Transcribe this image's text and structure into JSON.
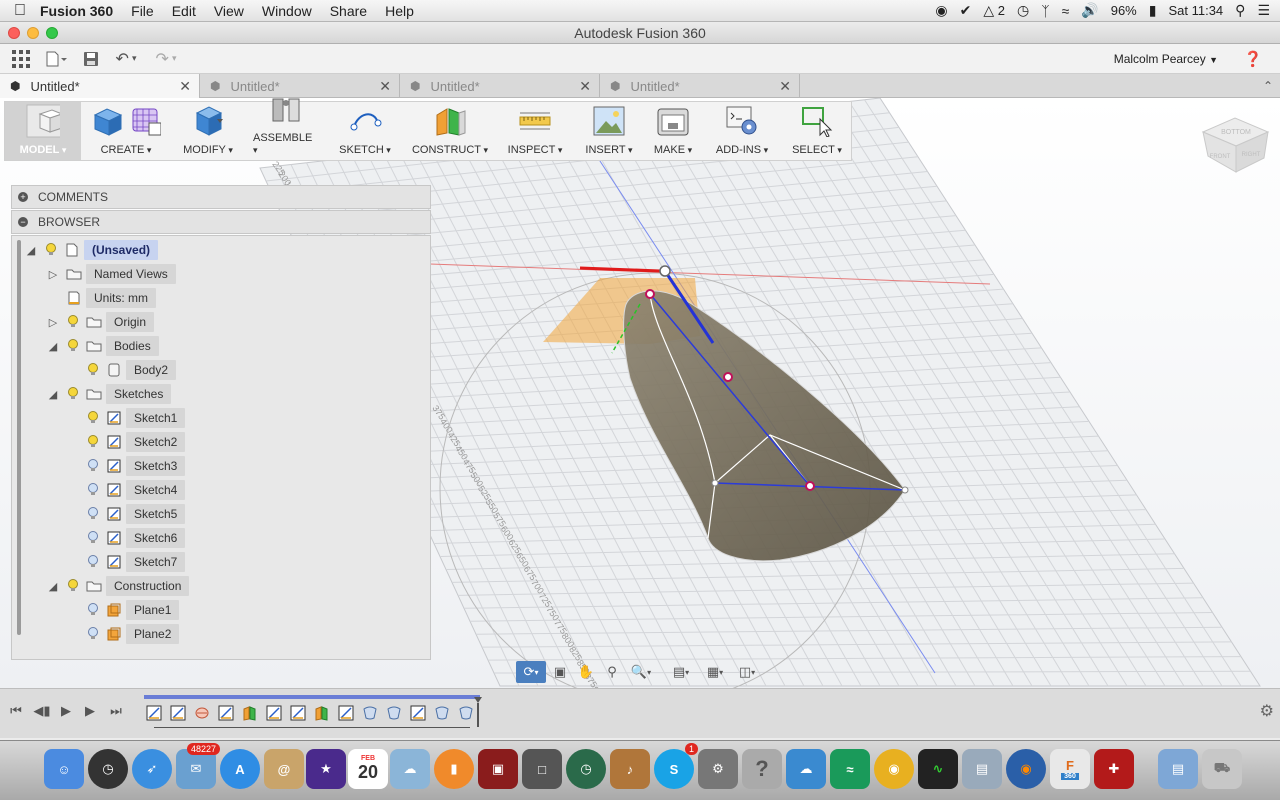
{
  "menubar": {
    "app_name": "Fusion 360",
    "menus": [
      "File",
      "Edit",
      "View",
      "Window",
      "Share",
      "Help"
    ],
    "status": {
      "adobe_count": "2",
      "battery": "96%",
      "clock": "Sat 11:34"
    }
  },
  "window": {
    "title": "Autodesk Fusion 360"
  },
  "quick_access": {
    "user": "Malcolm Pearcey"
  },
  "tabs": [
    {
      "label": "Untitled*"
    },
    {
      "label": "Untitled*"
    },
    {
      "label": "Untitled*"
    },
    {
      "label": "Untitled*"
    }
  ],
  "toolbar": {
    "model": "MODEL",
    "create": "CREATE",
    "modify": "MODIFY",
    "assemble": "ASSEMBLE",
    "sketch": "SKETCH",
    "construct": "CONSTRUCT",
    "inspect": "INSPECT",
    "insert": "INSERT",
    "make": "MAKE",
    "addins": "ADD-INS",
    "select": "SELECT"
  },
  "panels": {
    "comments": "COMMENTS",
    "browser": "BROWSER"
  },
  "browser": {
    "root": "(Unsaved)",
    "named_views": "Named Views",
    "units": "Units: mm",
    "origin": "Origin",
    "bodies": "Bodies",
    "body2": "Body2",
    "sketches": "Sketches",
    "sketch_items": [
      "Sketch1",
      "Sketch2",
      "Sketch3",
      "Sketch4",
      "Sketch5",
      "Sketch6",
      "Sketch7"
    ],
    "construction": "Construction",
    "planes": [
      "Plane1",
      "Plane2"
    ]
  },
  "viewcube": {
    "top": "BOTTOM",
    "front": "FRONT",
    "right": "RIGHT"
  },
  "grid_labels": [
    "225",
    "200",
    "175",
    "375",
    "400",
    "425",
    "450",
    "475",
    "500",
    "525",
    "550",
    "575",
    "600",
    "625",
    "650",
    "675",
    "700",
    "725",
    "750",
    "775",
    "800",
    "825",
    "850",
    "875",
    "900"
  ],
  "dock": {
    "mail_badge": "48227",
    "calendar_day": "20",
    "calendar_month": "FEB",
    "skype_badge": "1",
    "fusion_label": "360"
  },
  "colors": {
    "accent": "#4a7fbf",
    "selection": "#c7d3f0",
    "body": "#7a7160",
    "plane": "#f3a53b"
  }
}
